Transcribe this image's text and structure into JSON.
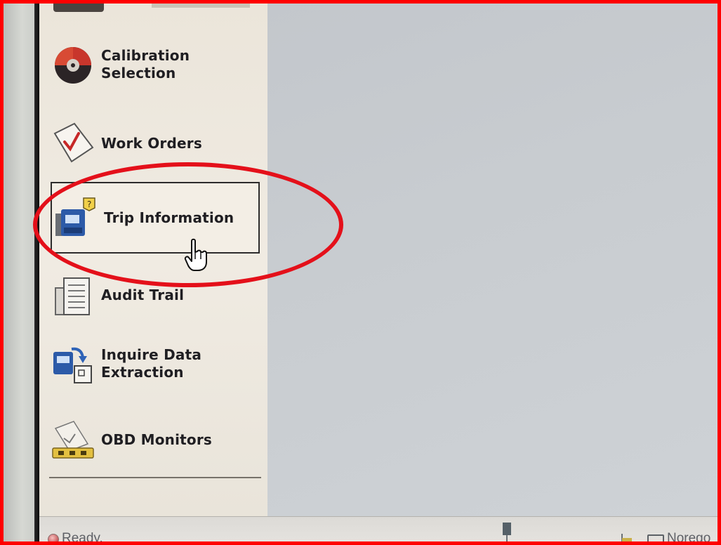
{
  "sidebar": {
    "items": [
      {
        "id": "calibration",
        "label": "Calibration\nSelection",
        "icon": "calibration-disc-icon"
      },
      {
        "id": "work-orders",
        "label": "Work Orders",
        "icon": "clipboard-check-icon"
      },
      {
        "id": "trip",
        "label": "Trip Information",
        "icon": "trip-info-icon"
      },
      {
        "id": "audit",
        "label": "Audit Trail",
        "icon": "audit-document-icon"
      },
      {
        "id": "inquire",
        "label": "Inquire Data\nExtraction",
        "icon": "data-extraction-icon"
      },
      {
        "id": "obd",
        "label": "OBD Monitors",
        "icon": "obd-monitor-icon"
      }
    ]
  },
  "status": {
    "text": "Ready.",
    "device": "Norego"
  },
  "colors": {
    "annotation": "#e4101a",
    "sidebar_bg": "#efe9df",
    "main_bg": "#c8ccd0"
  }
}
